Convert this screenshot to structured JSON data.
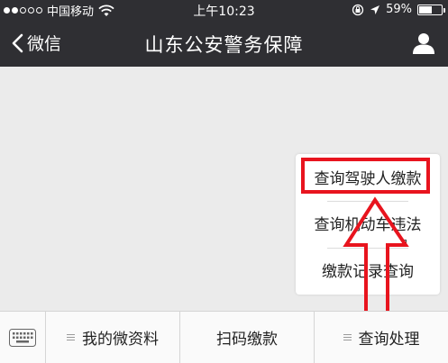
{
  "status_bar": {
    "carrier": "中国移动",
    "time": "上午10:23",
    "battery": "59%",
    "battery_level": 0.59
  },
  "nav": {
    "back_label": "微信",
    "title": "山东公安警务保障"
  },
  "popup_menu": {
    "items": [
      {
        "label": "查询驾驶人缴款"
      },
      {
        "label": "查询机动车违法"
      },
      {
        "label": "缴款记录查询"
      }
    ]
  },
  "bottom_menu": {
    "items": [
      {
        "label": "我的微资料"
      },
      {
        "label": "扫码缴款"
      },
      {
        "label": "查询处理"
      }
    ]
  },
  "colors": {
    "nav_background": "#2f2f33",
    "content_background": "#ebebeb",
    "annotation_red": "#e8141e"
  },
  "icons": {
    "back": "chevron-left-icon",
    "user": "user-icon",
    "keyboard": "keyboard-icon",
    "menu": "menu-lines-icon",
    "wifi": "wifi-icon",
    "location": "location-arrow-icon",
    "orientation_lock": "orientation-lock-icon"
  }
}
